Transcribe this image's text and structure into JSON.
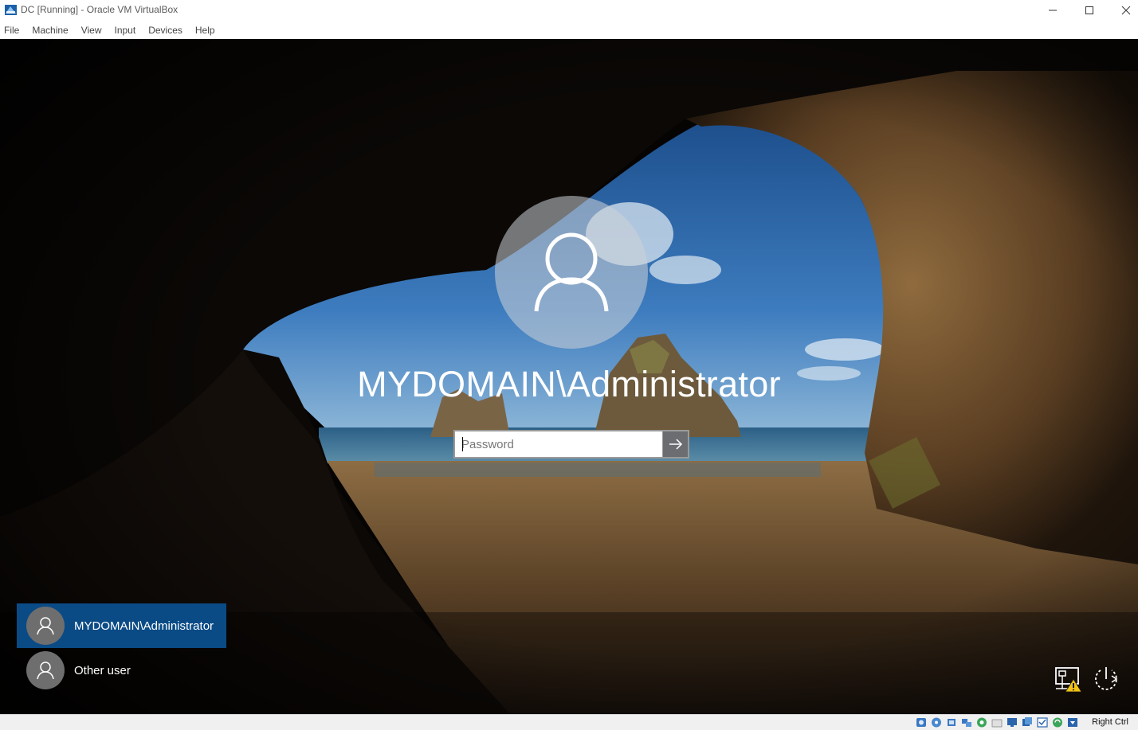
{
  "window": {
    "title": "DC [Running] - Oracle VM VirtualBox",
    "app_icon": "virtualbox-icon",
    "controls": [
      "minimize-icon",
      "maximize-icon",
      "close-icon"
    ]
  },
  "menubar": {
    "items": [
      {
        "label": "File"
      },
      {
        "label": "Machine"
      },
      {
        "label": "View"
      },
      {
        "label": "Input"
      },
      {
        "label": "Devices"
      },
      {
        "label": "Help"
      }
    ]
  },
  "login": {
    "user_display": "MYDOMAIN\\Administrator",
    "password_placeholder": "Password",
    "password_value": "",
    "submit_icon": "arrow-right-icon"
  },
  "user_list": [
    {
      "label": "MYDOMAIN\\Administrator",
      "selected": true
    },
    {
      "label": "Other user",
      "selected": false
    }
  ],
  "corner_icons": {
    "network": "network-warning-icon",
    "power": "power-icon"
  },
  "statusbar": {
    "host_key": "Right Ctrl",
    "icons": [
      "hard-disk-icon",
      "optical-drive-icon",
      "audio-icon",
      "network-adapter-icon",
      "usb-icon",
      "shared-folders-icon",
      "display-icon",
      "recording-icon",
      "cpu-icon",
      "mouse-integration-icon",
      "keyboard-icon"
    ]
  },
  "colors": {
    "selected_tile": "#0a4b86",
    "tile_avatar": "#6e6e6e",
    "submit_button": "#6b6d70"
  }
}
